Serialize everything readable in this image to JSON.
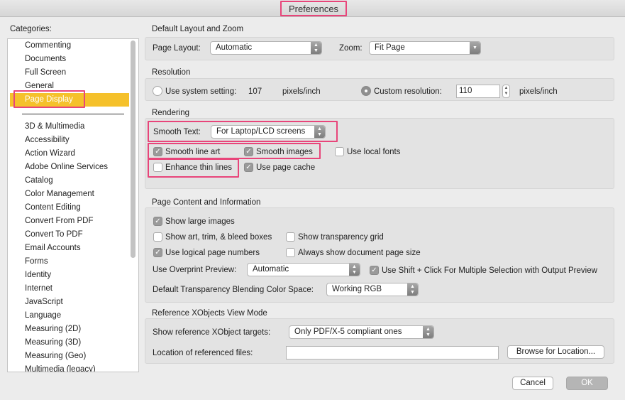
{
  "window": {
    "title": "Preferences"
  },
  "sidebar": {
    "label": "Categories:",
    "top_items": [
      "Commenting",
      "Documents",
      "Full Screen",
      "General",
      "Page Display"
    ],
    "selected": "Page Display",
    "items": [
      "3D & Multimedia",
      "Accessibility",
      "Action Wizard",
      "Adobe Online Services",
      "Catalog",
      "Color Management",
      "Content Editing",
      "Convert From PDF",
      "Convert To PDF",
      "Email Accounts",
      "Forms",
      "Identity",
      "Internet",
      "JavaScript",
      "Language",
      "Measuring (2D)",
      "Measuring (3D)",
      "Measuring (Geo)",
      "Multimedia (legacy)"
    ]
  },
  "layout_zoom": {
    "title": "Default Layout and Zoom",
    "page_layout_label": "Page Layout:",
    "page_layout_value": "Automatic",
    "zoom_label": "Zoom:",
    "zoom_value": "Fit Page"
  },
  "resolution": {
    "title": "Resolution",
    "system_label": "Use system setting:",
    "system_value": "107",
    "system_unit": "pixels/inch",
    "custom_label": "Custom resolution:",
    "custom_value": "110",
    "custom_unit": "pixels/inch",
    "selected": "custom"
  },
  "rendering": {
    "title": "Rendering",
    "smooth_text_label": "Smooth Text:",
    "smooth_text_value": "For Laptop/LCD screens",
    "smooth_line_art": "Smooth line art",
    "smooth_images": "Smooth images",
    "use_local_fonts": "Use local fonts",
    "enhance_thin_lines": "Enhance thin lines",
    "use_page_cache": "Use page cache"
  },
  "page_content": {
    "title": "Page Content and Information",
    "show_large_images": "Show large images",
    "show_art_trim": "Show art, trim, & bleed boxes",
    "show_transparency_grid": "Show transparency grid",
    "use_logical_page_numbers": "Use logical page numbers",
    "always_show_doc_size": "Always show document page size",
    "overprint_label": "Use Overprint Preview:",
    "overprint_value": "Automatic",
    "shift_click": "Use Shift + Click For Multiple Selection with Output Preview",
    "blending_label": "Default Transparency Blending Color Space:",
    "blending_value": "Working RGB"
  },
  "xobjects": {
    "title": "Reference XObjects View Mode",
    "targets_label": "Show reference XObject targets:",
    "targets_value": "Only PDF/X-5 compliant ones",
    "location_label": "Location of referenced files:",
    "location_value": "",
    "browse_label": "Browse for Location..."
  },
  "footer": {
    "cancel_label": "Cancel",
    "ok_label": "OK"
  },
  "colors": {
    "selection": "#f5c12b",
    "highlight": "#e8457a"
  }
}
